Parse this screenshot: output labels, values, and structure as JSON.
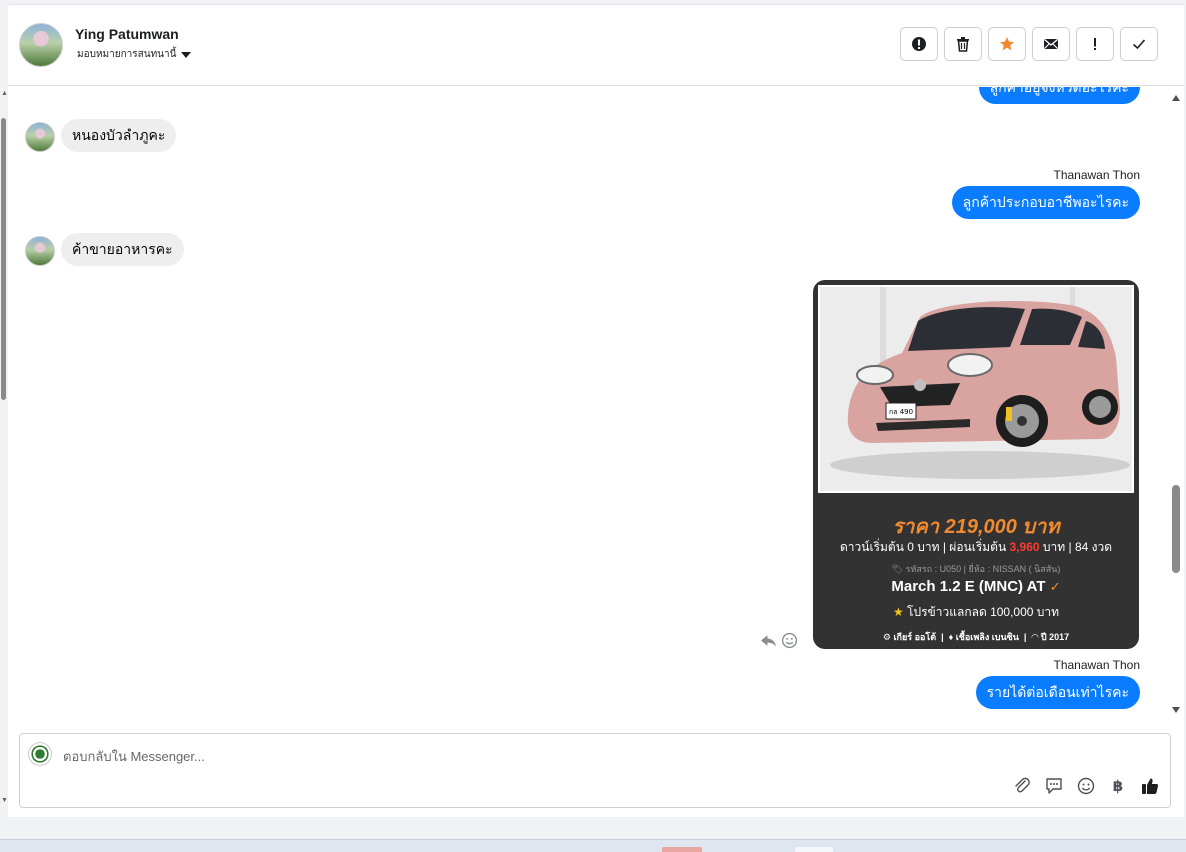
{
  "header": {
    "user_name": "Ying Patumwan",
    "assign_label": "มอบหมายการสนทนานี้"
  },
  "actions": [
    {
      "name": "spam-button",
      "icon": "alert-circle-icon"
    },
    {
      "name": "delete-button",
      "icon": "trash-icon"
    },
    {
      "name": "star-button",
      "icon": "star-icon"
    },
    {
      "name": "mark-unread-button",
      "icon": "envelope-icon"
    },
    {
      "name": "follow-up-button",
      "icon": "exclamation-icon"
    },
    {
      "name": "mark-done-button",
      "icon": "check-icon"
    }
  ],
  "messages": {
    "m0_out": "ลูกค้าอยู่จังหวัดอะไรคะ",
    "m1_in": "หนองบัวลำภูคะ",
    "m2_sender": "Thanawan Thon",
    "m2_out": "ลูกค้าประกอบอาชีพอะไรคะ",
    "m3_in": "ค้าขายอาหารคะ",
    "m5_sender": "Thanawan Thon",
    "m5_out": "รายได้ต่อเดือนเท่าไรคะ"
  },
  "car_card": {
    "price": "ราคา 219,000 บาท",
    "down_prefix": "ดาวน์เริ่มต้น 0 บาท | ผ่อนเริ่มต้น",
    "down_amount": "3,960",
    "down_suffix": "บาท | 84 งวด",
    "code_line": "รหัสรถ : U050 | ยี่ห้อ : NISSAN ( นิสสัน)",
    "model": "March 1.2 E (MNC) AT",
    "promo": "โปรข้าวแลกลด 100,000 บาท",
    "spec_gear": "เกียร์ ออโต้",
    "spec_fuel": "เชื้อเพลิง เบนซิน",
    "spec_year": "ปี 2017",
    "plate": "กล 490",
    "colors": {
      "background": "#323232",
      "price": "#ef8a2f",
      "highlight": "#ff3b30",
      "car_body": "#d9a3a0"
    }
  },
  "composer": {
    "placeholder": "ตอบกลับใน Messenger...",
    "currency_symbol": "฿"
  },
  "colors": {
    "outgoing_bubble": "#0a7cff",
    "incoming_bubble": "#eeeeee",
    "like": "#1c1e21"
  }
}
